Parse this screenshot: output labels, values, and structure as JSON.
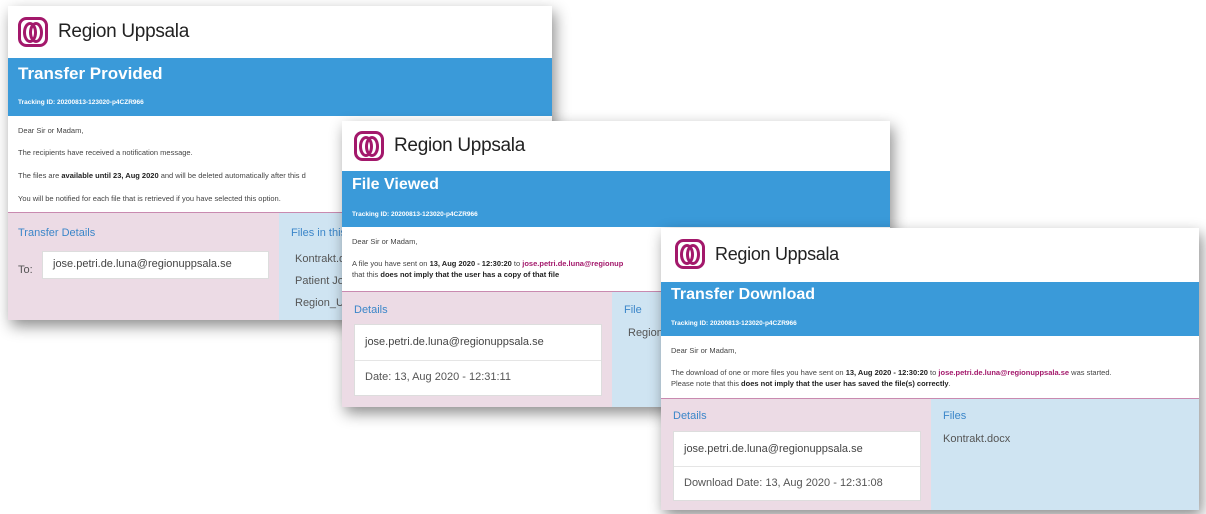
{
  "brand": {
    "name": "Region Uppsala",
    "color_primary": "#a3186b",
    "color_banner": "#3a9ad9"
  },
  "cards": {
    "provided": {
      "logo_text": "Region Uppsala",
      "title": "Transfer Provided",
      "tracking": "Tracking ID: 20200813-123020-p4CZR966",
      "greeting": "Dear Sir or Madam,",
      "line1": "The recipients have received a notification message.",
      "line2_pre": "The files are ",
      "line2_bold": "available until 23, Aug 2020",
      "line2_post": " and will be deleted automatically after this d",
      "line3": "You will be notified for each file that is retrieved if you have selected this option.",
      "details_heading": "Transfer Details",
      "to_label": "To:",
      "to_value": "jose.petri.de.luna@regionuppsala.se",
      "files_heading": "Files in this",
      "files": [
        "Kontrakt.d",
        "Patient Jo",
        "Region_U"
      ]
    },
    "viewed": {
      "logo_text": "Region Uppsala",
      "title": "File Viewed",
      "tracking": "Tracking ID: 20200813-123020-p4CZR966",
      "greeting": "Dear Sir or Madam,",
      "line1_pre": "A file you have sent on ",
      "line1_date": "13, Aug 2020 - 12:30:20",
      "line1_mid": " to ",
      "line1_email": "jose.petri.de.luna@regionup",
      "line2_pre": "that this ",
      "line2_bold": "does not imply that the user has a copy of that file",
      "details_heading": "Details",
      "email": "jose.petri.de.luna@regionuppsala.se",
      "date_line": "Date:  13, Aug 2020 - 12:31:11",
      "files_heading": "File",
      "file_partial": "Region"
    },
    "download": {
      "logo_text": "Region Uppsala",
      "title": "Transfer Download",
      "tracking": "Tracking ID: 20200813-123020-p4CZR966",
      "greeting": "Dear Sir or Madam,",
      "line1_pre": "The download of one or more files you have sent on ",
      "line1_date": "13, Aug 2020 - 12:30:20",
      "line1_mid": " to ",
      "line1_email": "jose.petri.de.luna@regionuppsala.se",
      "line1_post": " was started.",
      "line2_pre": "Please note that this ",
      "line2_bold": "does not imply that the user has saved the file(s) correctly",
      "line2_post": ".",
      "details_heading": "Details",
      "email": "jose.petri.de.luna@regionuppsala.se",
      "date_line": "Download Date:  13, Aug 2020 - 12:31:08",
      "files_heading": "Files",
      "file": "Kontrakt.docx"
    }
  }
}
